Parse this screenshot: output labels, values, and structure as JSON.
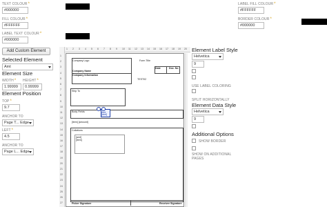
{
  "left_panel": {
    "text_colour_label": "TEXT COLOUR",
    "text_colour_value": "#000000",
    "fill_colour_label": "FILL COLOUR",
    "fill_colour_value": "#FFFFFF",
    "label_text_colour_label": "LABEL TEXT COLOUR",
    "label_text_colour_value": "#000000",
    "add_custom_element": "Add Custom Element",
    "selected_element_heading": "Selected Element",
    "selected_element_value": "Amt",
    "element_size_heading": "Element Size",
    "width_label": "WIDTH",
    "width_value": "1.99999",
    "height_label": "HEIGHT",
    "height_value": "0.99999",
    "element_position_heading": "Element Position",
    "top_label": "TOP",
    "top_value": "9.7",
    "anchor_to_label": "ANCHOR TO",
    "anchor_top_value": "Page T... Edge",
    "left_label": "LEFT",
    "left_value": "4.5",
    "anchor_left_value": "Page L... Edge"
  },
  "top_right": {
    "label_fill_colour_label": "LABEL FILL COLOUR",
    "label_fill_colour_value": "#FFFFFF",
    "border_colour_label": "BORDER COLOUR",
    "border_colour_value": "#000000"
  },
  "right_panel": {
    "label_style_heading": "Element Label Style",
    "label_font": "Helvetica",
    "label_size": "9",
    "use_label_coloring": "USE LABEL COLORING",
    "split_horizontally": "SPLIT HORIZONTALLY",
    "data_style_heading": "Element Data Style",
    "data_font": "Helvetica",
    "data_size": "9",
    "additional_options_heading": "Additional Options",
    "show_border": "SHOW BORDER",
    "show_on_additional_pages": "SHOW ON ADDITIONAL PAGES"
  },
  "canvas": {
    "h_ticks": [
      "1",
      "2",
      "3",
      "4",
      "5",
      "6",
      "7",
      "8",
      "9",
      "10",
      "11",
      "12",
      "13",
      "14",
      "15",
      "16",
      "17",
      "18",
      "19",
      "20"
    ],
    "v_ticks": [
      "1",
      "2",
      "3",
      "4",
      "5",
      "6",
      "7",
      "8",
      "9",
      "10",
      "11",
      "12",
      "13",
      "14",
      "15",
      "16",
      "17",
      "18",
      "19",
      "20",
      "21",
      "22",
      "23",
      "24",
      "25",
      "26",
      "27"
    ],
    "company_logo": "Company Logo",
    "form_title": "Form Title",
    "company_name": "Company Name",
    "company_information": "Company Information",
    "date": "Date",
    "doc_no": "Doc. No",
    "test": "TEST02",
    "ship_to": "Ship To",
    "body_fields": "Body Fields",
    "amt": "Amt",
    "amt_token": "[amt]",
    "item_amount": "[item] [amount]",
    "collations": "Collations",
    "coll_item1": "[amt]",
    "coll_item2": "[item]",
    "picker_signature": "Picker Signature",
    "receiver_signature": "Receiver Signature"
  },
  "colors": {
    "accent_gold": "#d4a017",
    "selection_blue": "#1f3fa8"
  }
}
